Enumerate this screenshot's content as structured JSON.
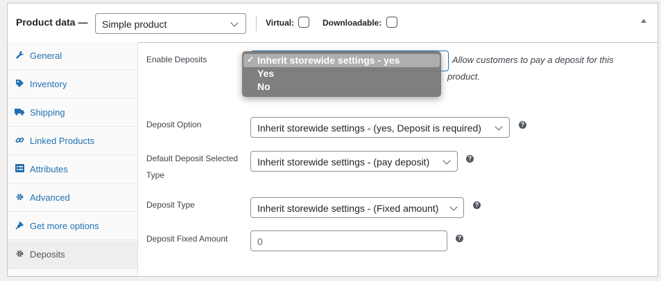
{
  "header": {
    "title": "Product data —",
    "product_type": "Simple product",
    "virtual_label": "Virtual:",
    "downloadable_label": "Downloadable:"
  },
  "tabs": [
    {
      "label": "General",
      "icon": "wrench-icon"
    },
    {
      "label": "Inventory",
      "icon": "tag-icon"
    },
    {
      "label": "Shipping",
      "icon": "truck-icon"
    },
    {
      "label": "Linked Products",
      "icon": "link-icon"
    },
    {
      "label": "Attributes",
      "icon": "list-icon"
    },
    {
      "label": "Advanced",
      "icon": "gear-icon"
    },
    {
      "label": "Get more options",
      "icon": "plugin-icon"
    },
    {
      "label": "Deposits",
      "icon": "gear-icon",
      "active": true
    }
  ],
  "fields": {
    "enable_deposits": {
      "label": "Enable Deposits",
      "description": "Allow customers to pay a deposit for this product.",
      "desc_line1": "Allow customers to pay a deposit for this",
      "desc_line2": "product.",
      "options": [
        "Inherit storewide settings - yes",
        "Yes",
        "No"
      ],
      "selected": "Inherit storewide settings - yes",
      "check": "✓"
    },
    "deposit_option": {
      "label": "Deposit Option",
      "value": "Inherit storewide settings - (yes, Deposit is required)"
    },
    "default_selected_type": {
      "label_line1": "Default Deposit Selected",
      "label_line2": "Type",
      "value": "Inherit storewide settings - (pay deposit)"
    },
    "deposit_type": {
      "label": "Deposit Type",
      "value": "Inherit storewide settings - (Fixed amount)"
    },
    "deposit_fixed_amount": {
      "label": "Deposit Fixed Amount",
      "value": "0"
    }
  },
  "help_glyph": "?",
  "colors": {
    "accent": "#2271b1",
    "border": "#8c8f94"
  }
}
